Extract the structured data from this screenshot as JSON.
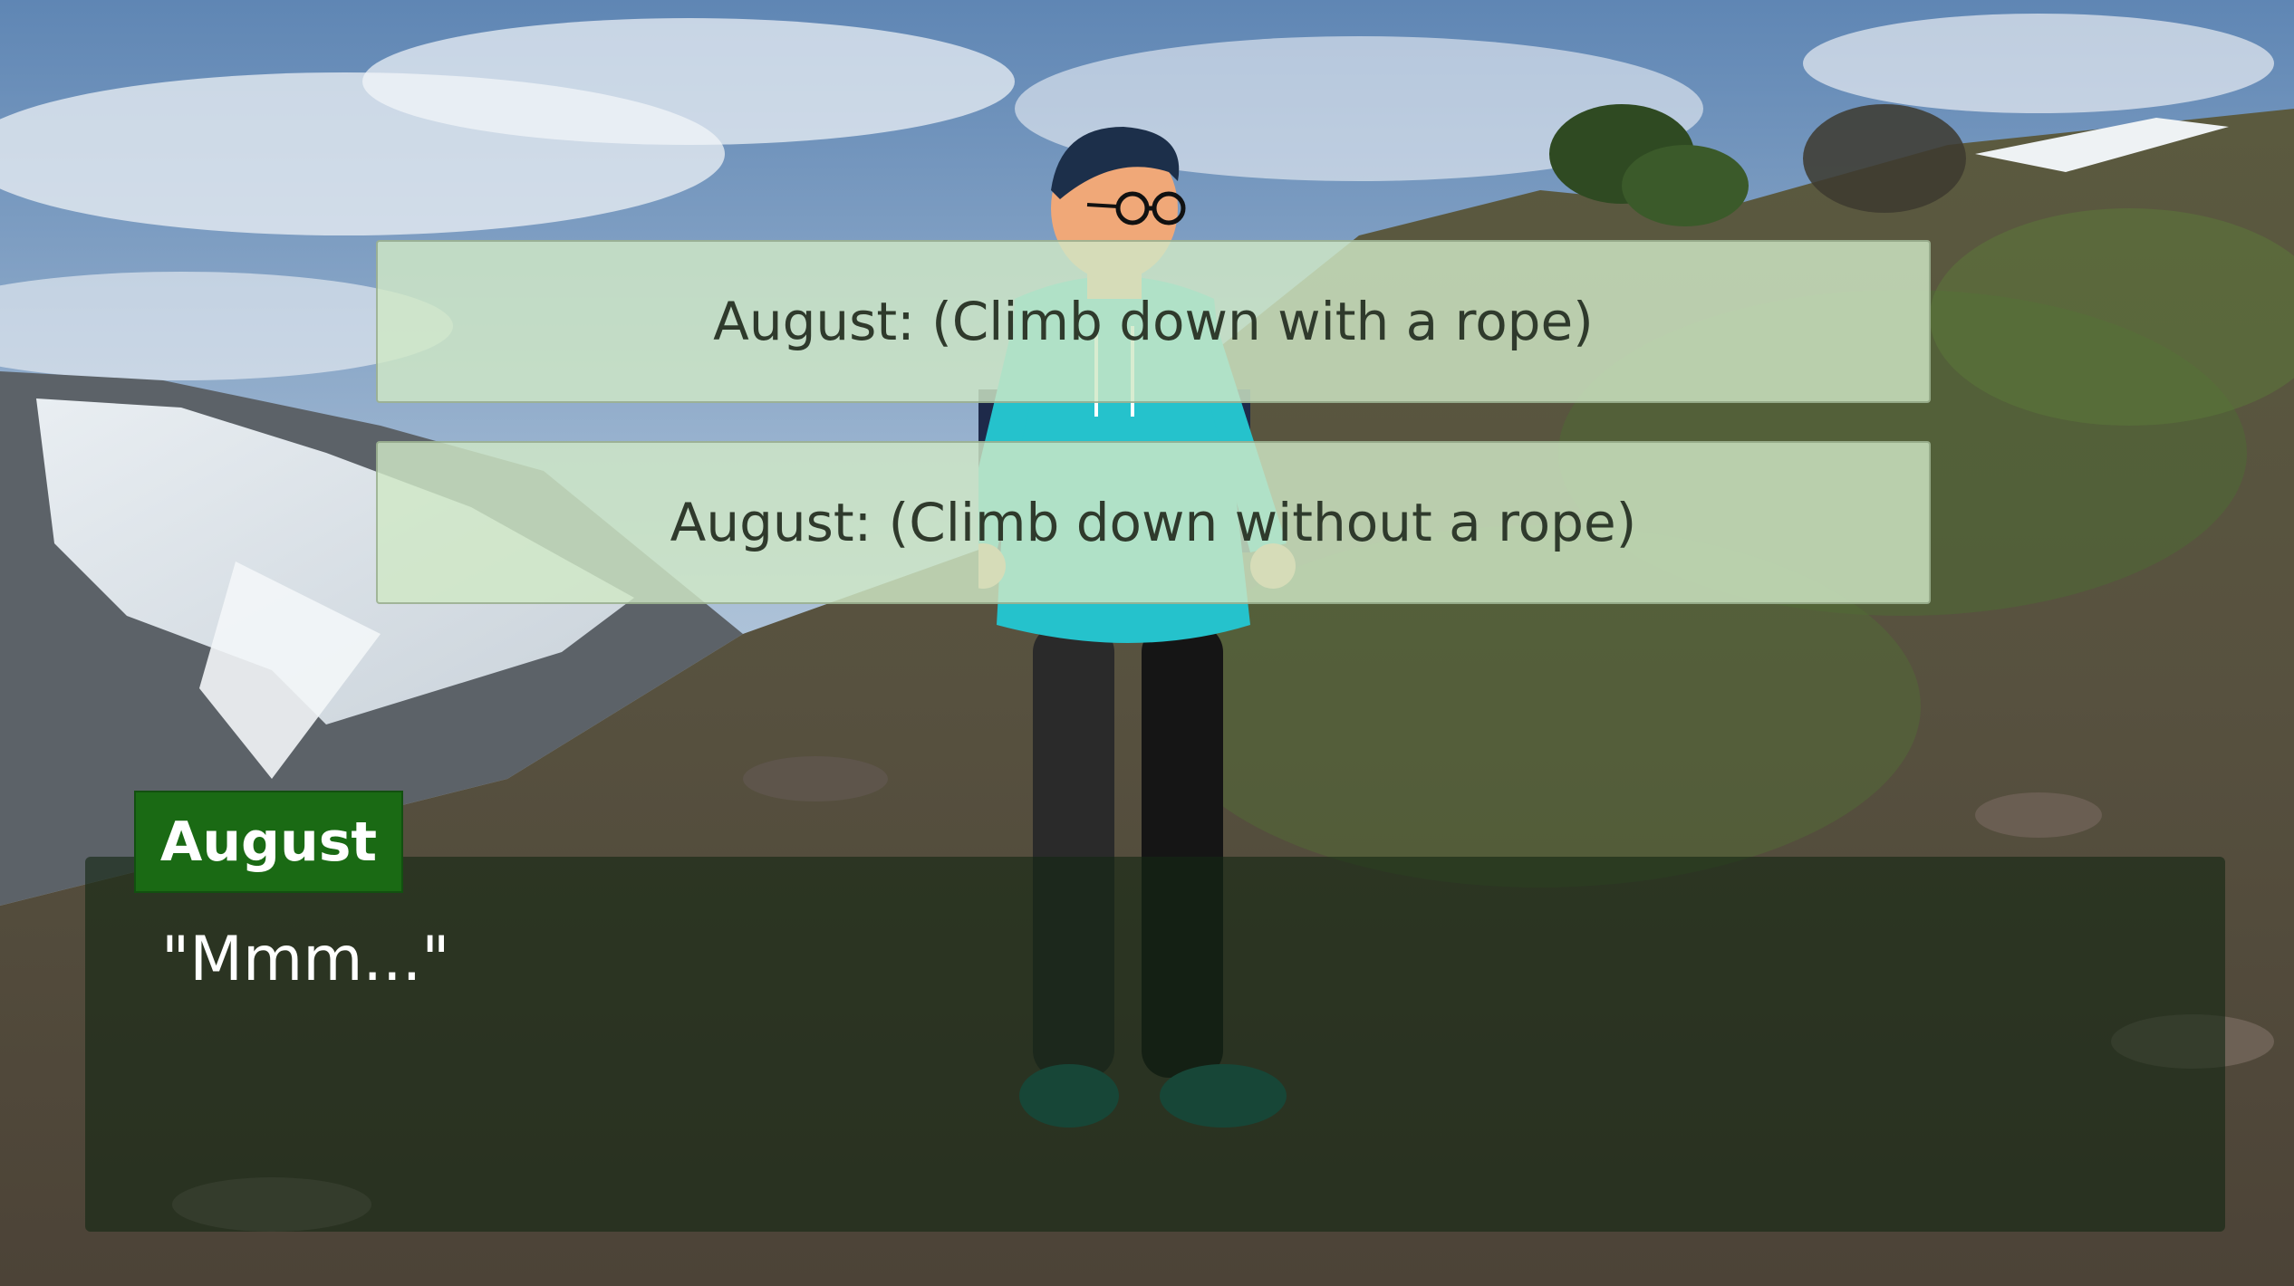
{
  "choices": [
    {
      "label": "August: (Climb down with a rope)"
    },
    {
      "label": "August: (Climb down without a rope)"
    }
  ],
  "dialogue": {
    "speaker": "August",
    "text": "\"Mmm...\""
  },
  "colors": {
    "choice_bg": "#d0e8c6",
    "namebox_bg": "#1a6a14",
    "dialogue_bg": "#142614"
  },
  "scene": {
    "background": "mountain-hillside",
    "character": "august-hiker"
  }
}
